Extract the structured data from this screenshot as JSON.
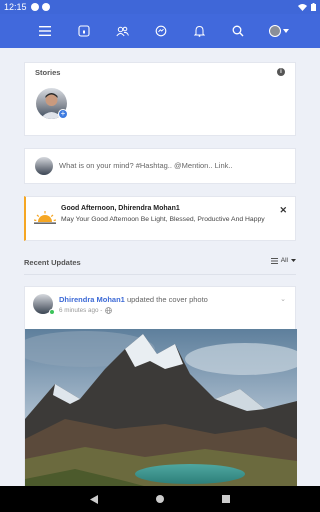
{
  "status_bar": {
    "time": "12:15"
  },
  "stories": {
    "title": "Stories"
  },
  "composer": {
    "placeholder": "What is on your mind? #Hashtag.. @Mention.. Link.."
  },
  "greeting": {
    "title": "Good Afternoon, Dhirendra Mohan1",
    "message": "May Your Good Afternoon Be Light, Blessed, Productive And Happy"
  },
  "feed": {
    "section_title": "Recent Updates",
    "filter_label": "All"
  },
  "post": {
    "author": "Dhirendra Mohan1",
    "action": "updated the cover photo",
    "time": "6 minutes ago -"
  },
  "colors": {
    "nav_blue": "#4169dc",
    "accent_orange": "#f5a623",
    "link_blue": "#3d6ad6"
  }
}
